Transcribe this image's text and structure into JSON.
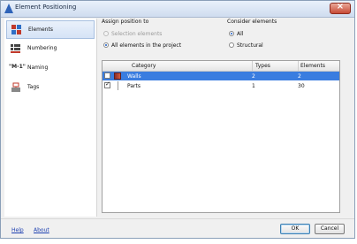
{
  "window": {
    "title": "Element Positioning"
  },
  "sidebar": {
    "items": [
      {
        "label": "Elements",
        "icon": "elements-icon",
        "selected": true
      },
      {
        "label": "Numbering",
        "icon": "numbering-icon",
        "selected": false
      },
      {
        "label": "Naming",
        "icon": "naming-icon",
        "icon_text": "\"M-1\"",
        "selected": false
      },
      {
        "label": "Tags",
        "icon": "tags-icon",
        "selected": false
      }
    ]
  },
  "assign": {
    "label": "Assign position to",
    "options": [
      {
        "label": "Selection elements",
        "selected": false,
        "disabled": true
      },
      {
        "label": "All elements in the project",
        "selected": true,
        "disabled": false
      }
    ]
  },
  "consider": {
    "label": "Consider elements",
    "options": [
      {
        "label": "All",
        "selected": true
      },
      {
        "label": "Structural",
        "selected": false
      }
    ]
  },
  "table": {
    "columns": [
      "Category",
      "Types",
      "Elements"
    ],
    "rows": [
      {
        "category": "Walls",
        "types": "2",
        "elements": "2",
        "checked": false,
        "selected": true,
        "icon": "wall-icon"
      },
      {
        "category": "Parts",
        "types": "1",
        "elements": "30",
        "checked": true,
        "selected": false,
        "icon": ""
      }
    ]
  },
  "footer": {
    "help": "Help",
    "about": "About",
    "ok": "OK",
    "cancel": "Cancel"
  },
  "colors": {
    "selection": "#3a7de0",
    "link": "#1c3fb0"
  }
}
